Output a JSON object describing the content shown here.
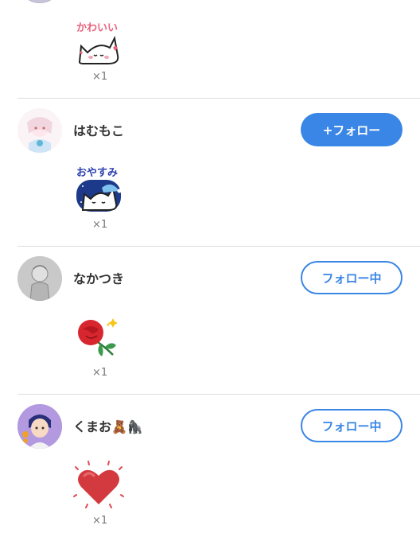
{
  "items": [
    {
      "sticker": {
        "name": "cat-kawaii-sticker",
        "caption": "かわいい",
        "caption_color": "#e8637e"
      },
      "count": "×1"
    },
    {
      "username": "はむもこ",
      "button": "+フォロー",
      "button_state": "follow",
      "sticker": {
        "name": "cat-oyasumi-sticker",
        "caption": "おやすみ",
        "caption_color": "#2a3fb0"
      },
      "count": "×1"
    },
    {
      "username": "なかつき",
      "button": "フォロー中",
      "button_state": "following",
      "sticker": {
        "name": "rose-sticker"
      },
      "count": "×1"
    },
    {
      "username": "くまお🧸🦍",
      "button": "フォロー中",
      "button_state": "following",
      "sticker": {
        "name": "heart-sticker"
      },
      "count": "×1"
    }
  ],
  "colors": {
    "accent": "#3a86e6",
    "divider": "#dddddd",
    "count": "#777777"
  }
}
